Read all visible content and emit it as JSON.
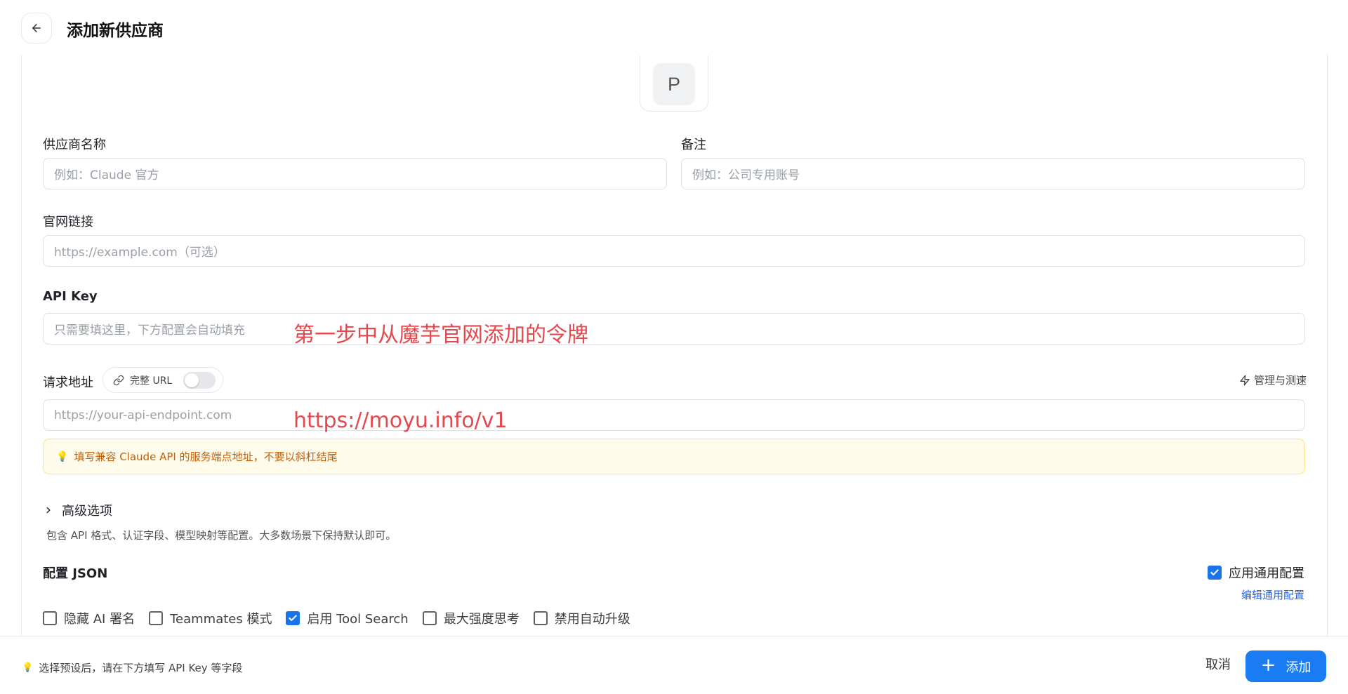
{
  "header": {
    "title": "添加新供应商"
  },
  "avatar": {
    "letter": "P"
  },
  "fields": {
    "provider_name": {
      "label": "供应商名称",
      "placeholder": "例如：Claude 官方"
    },
    "note": {
      "label": "备注",
      "placeholder": "例如：公司专用账号"
    },
    "website": {
      "label": "官网链接",
      "placeholder": "https://example.com（可选）"
    },
    "api_key": {
      "label": "API Key",
      "placeholder": "只需要填这里，下方配置会自动填充"
    },
    "endpoint": {
      "label": "请求地址",
      "placeholder": "https://your-api-endpoint.com"
    }
  },
  "annotations": {
    "api_key": "第一步中从魔芋官网添加的令牌",
    "endpoint": "https://moyu.info/v1"
  },
  "endpoint_controls": {
    "full_url_label": "完整 URL",
    "full_url_enabled": false,
    "manage_label": "管理与测速"
  },
  "hint": {
    "text": "填写兼容 Claude API 的服务端点地址，不要以斜杠结尾"
  },
  "advanced": {
    "title": "高级选项",
    "description": "包含 API 格式、认证字段、模型映射等配置。大多数场景下保持默认即可。"
  },
  "config_json": {
    "label": "配置 JSON",
    "apply_common_label": "应用通用配置",
    "apply_common_checked": true,
    "edit_common_label": "编辑通用配置",
    "options": [
      {
        "label": "隐藏 AI 署名",
        "checked": false
      },
      {
        "label": "Teammates 模式",
        "checked": false
      },
      {
        "label": "启用 Tool Search",
        "checked": true
      },
      {
        "label": "最大强度思考",
        "checked": false
      },
      {
        "label": "禁用自动升级",
        "checked": false
      }
    ]
  },
  "footer": {
    "tip": "选择预设后，请在下方填写 API Key 等字段",
    "cancel_label": "取消",
    "add_label": "添加"
  },
  "colors": {
    "accent": "#1a7cf2",
    "annotation": "#e5484d",
    "hint_bg": "#fffbea",
    "hint_text": "#c2610c"
  }
}
